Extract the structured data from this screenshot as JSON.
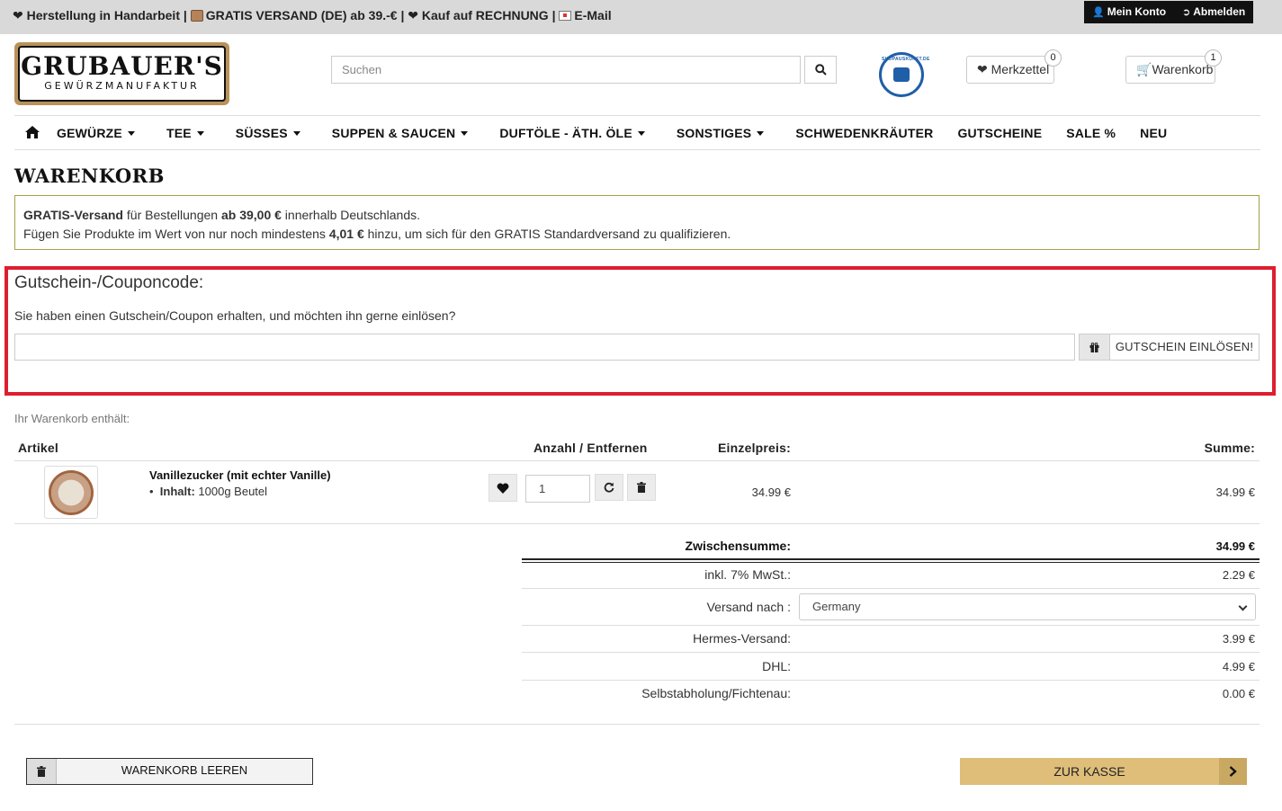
{
  "topbar": {
    "item1": "Herstellung in Handarbeit",
    "sep": "|",
    "item2": "GRATIS VERSAND (DE) ab 39.-€",
    "item3": "Kauf auf RECHNUNG",
    "item4": "E-Mail",
    "account_label": "Mein Konto",
    "logout_label": "Abmelden"
  },
  "logo": {
    "line1": "GRUBAUER'S",
    "line2": "GEWÜRZMANUFAKTUR"
  },
  "search": {
    "placeholder": "Suchen"
  },
  "seal": {
    "text": "SHOPAUSKUNFT.DE"
  },
  "wishlist": {
    "label": "Merkzettel",
    "count": "0"
  },
  "cart": {
    "label": "Warenkorb",
    "count": "1"
  },
  "nav": [
    {
      "label": "GEWÜRZE"
    },
    {
      "label": "TEE"
    },
    {
      "label": "SÜSSES"
    },
    {
      "label": "SUPPEN & SAUCEN"
    },
    {
      "label": "DUFTÖLE - ÄTH. ÖLE"
    },
    {
      "label": "SONSTIGES"
    },
    {
      "label": "SCHWEDENKRÄUTER"
    },
    {
      "label": "GUTSCHEINE"
    },
    {
      "label": "SALE %"
    },
    {
      "label": "NEU"
    }
  ],
  "page_title": "WARENKORB",
  "shipping_notice": {
    "l1_b1": "GRATIS-Versand",
    "l1_t1": " für Bestellungen ",
    "l1_b2": "ab 39,00 €",
    "l1_t2": " innerhalb Deutschlands.",
    "l2_t1": "Fügen Sie Produkte im Wert von nur noch mindestens ",
    "l2_b1": "4,01 €",
    "l2_t2": " hinzu, um sich für den GRATIS Standardversand zu qualifizieren."
  },
  "coupon": {
    "title": "Gutschein-/Couponcode:",
    "text": "Sie haben einen Gutschein/Coupon erhalten, und möchten ihn gerne einlösen?",
    "value": "",
    "button": "GUTSCHEIN EINLÖSEN!"
  },
  "cart_contains": "Ihr Warenkorb enthält:",
  "table": {
    "col_article": "Artikel",
    "col_qty": "Anzahl / Entfernen",
    "col_unit": "Einzelpreis:",
    "col_sum": "Summe:"
  },
  "item": {
    "name": "Vanillezucker (mit echter Vanille)",
    "attr_label": "Inhalt:",
    "attr_value": "1000g Beutel",
    "qty": "1",
    "unit_price": "34.99 €",
    "sum": "34.99 €"
  },
  "totals": {
    "subtotal_label": "Zwischensumme:",
    "subtotal": "34.99 €",
    "vat_label": "inkl. 7% MwSt.:",
    "vat": "2.29 €",
    "ship_to_label": "Versand nach :",
    "ship_to": "Germany",
    "hermes_label": "Hermes-Versand:",
    "hermes": "3.99 €",
    "dhl_label": "DHL:",
    "dhl": "4.99 €",
    "pickup_label": "Selbstabholung/Fichtenau:",
    "pickup": "0.00 €"
  },
  "buttons": {
    "empty_cart": "WARENKORB LEEREN",
    "checkout": "ZUR KASSE"
  }
}
